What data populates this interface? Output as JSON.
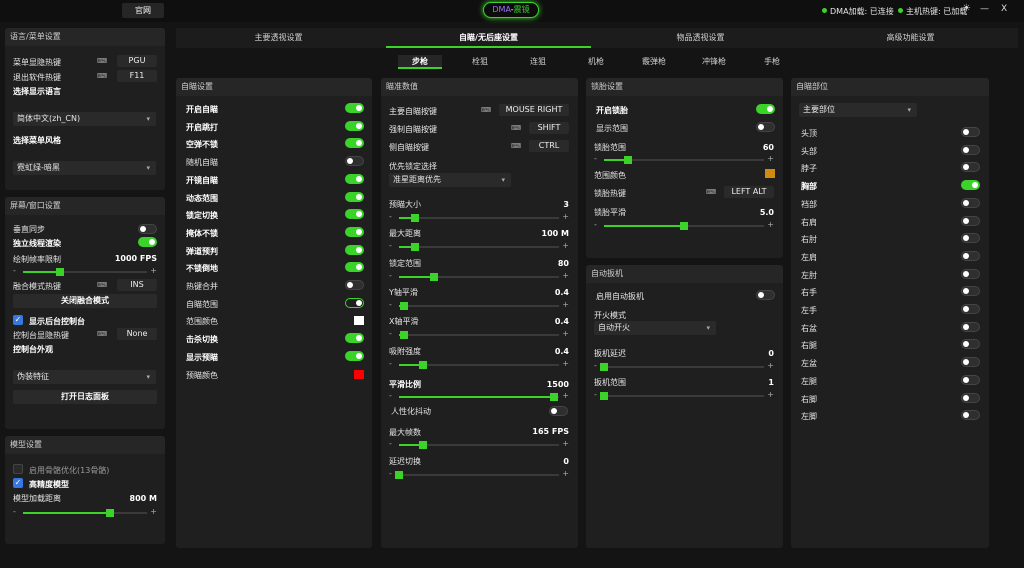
{
  "topbar": {
    "official_site": "官网",
    "title_left": "DMA",
    "title_sep": "-",
    "title_right": "震镜",
    "dma_status": "DMA加载: 已连接",
    "host_status": "主机热键: 已加载",
    "min_btn": "—",
    "close_btn": "X"
  },
  "main_tabs": [
    "主要透视设置",
    "自瞄/无后座设置",
    "物品透视设置",
    "高级功能设置"
  ],
  "weapon_tabs": [
    "步枪",
    "栓狙",
    "连狙",
    "机枪",
    "霰弹枪",
    "冲锋枪",
    "手枪"
  ],
  "lang_panel": {
    "title": "语言/菜单设置",
    "menu_hotkey": "菜单显隐热键",
    "menu_hotkey_key": "PGU",
    "exit_hotkey": "退出软件热键",
    "exit_hotkey_key": "F11",
    "choose_lang": "选择显示语言",
    "lang_value": "简体中文(zh_CN)",
    "choose_style": "选择菜单风格",
    "style_value": "霓虹绿-暗黑"
  },
  "screen_panel": {
    "title": "屏幕/窗口设置",
    "vsync": "垂直同步",
    "independent": "独立线程渲染",
    "fps_limit": "绘制帧率限制",
    "fps_value": "1000 FPS",
    "fps_fraction": 0.3,
    "fusion_hotkey": "融合模式热键",
    "fusion_key": "INS",
    "close_fusion": "关闭融合模式",
    "show_console": "显示后台控制台",
    "console_hotkey": "控制台显隐热键",
    "console_key": "None",
    "console_look": "控制台外观",
    "disguise": "伪装特征",
    "open_log": "打开日志面板"
  },
  "model_panel": {
    "title": "模型设置",
    "skeleton_opt": "启用骨骼优化(13骨骼)",
    "hq_model": "高精度模型",
    "load_dist": "模型加载距离",
    "load_value": "800 M",
    "load_fraction": 0.7
  },
  "aim_settings": {
    "title": "自瞄设置",
    "items": [
      "开启自瞄",
      "开启跳打",
      "空弹不锁",
      "随机自瞄",
      "开镜自瞄",
      "动态范围",
      "锁定切换",
      "掩体不锁",
      "弹道预判",
      "不锁倒地",
      "热键合并",
      "自瞄范围",
      "范围颜色",
      "击杀切换",
      "显示预瞄",
      "预瞄颜色"
    ],
    "colors": {
      "range": "#ffffff",
      "preview": "#ff0000"
    }
  },
  "aim_params": {
    "title": "瞄准数值",
    "main_key_label": "主要自瞄按键",
    "main_key": "MOUSE RIGHT",
    "force_key_label": "强制自瞄按键",
    "force_key": "SHIFT",
    "side_key_label": "侧自瞄按键",
    "side_key": "CTRL",
    "priority_label": "优先锁定选择",
    "priority_value": "准星距离优先",
    "sliders": [
      {
        "label": "预瞄大小",
        "value": "3",
        "fraction": 0.1
      },
      {
        "label": "最大距离",
        "value": "100 M",
        "fraction": 0.1
      },
      {
        "label": "锁定范围",
        "value": "80",
        "fraction": 0.22
      },
      {
        "label": "Y轴平滑",
        "value": "0.4",
        "fraction": 0.03
      },
      {
        "label": "X轴平滑",
        "value": "0.4",
        "fraction": 0.03
      },
      {
        "label": "吸附强度",
        "value": "0.4",
        "fraction": 0.15
      }
    ],
    "smooth_ratio_label": "平滑比例",
    "smooth_ratio": "1500",
    "smooth_fraction": 0.97,
    "jitter_label": "人性化抖动",
    "max_tick_label": "最大帧数",
    "max_tick": "165 FPS",
    "max_tick_fraction": 0.15,
    "delay_label": "延迟切换",
    "delay": "0",
    "delay_fraction": 0.0
  },
  "bone_lock": {
    "title": "锁胎设置",
    "enable": "开启锁胎",
    "show_range": "显示范围",
    "range_label": "锁胎范围",
    "range_value": "60",
    "range_fraction": 0.15,
    "color_label": "范围颜色",
    "color": "#d08a10",
    "hotkey_label": "锁胎热键",
    "hotkey": "LEFT ALT",
    "smooth_label": "锁胎平滑",
    "smooth_value": "5.0",
    "smooth_fraction": 0.5
  },
  "trigger": {
    "title": "自动扳机",
    "enable": "启用自动扳机",
    "mode_label": "开火模式",
    "mode_value": "自动开火",
    "delay_label": "扳机延迟",
    "delay_value": "0",
    "range_label": "扳机范围",
    "range_value": "1"
  },
  "aim_parts": {
    "title": "自瞄部位",
    "main_label": "主要部位",
    "parts": [
      "头顶",
      "头部",
      "脖子",
      "胸部",
      "裆部",
      "右肩",
      "右肘",
      "左肩",
      "左肘",
      "右手",
      "左手",
      "右盆",
      "右腿",
      "左盆",
      "左腿",
      "右脚",
      "左脚"
    ],
    "enabled": "胸部"
  }
}
